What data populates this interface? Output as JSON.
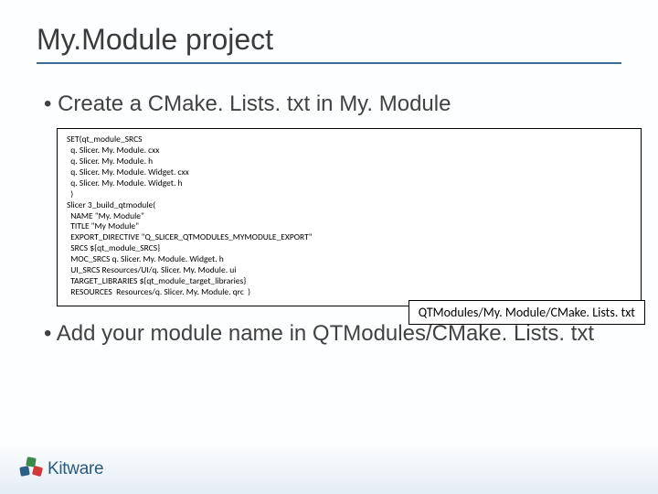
{
  "title": "My.Module project",
  "bullets": {
    "b1": "Create a CMake. Lists. txt in My. Module",
    "b2": "Add your module name in QTModules/CMake. Lists. txt"
  },
  "code": "SET(qt_module_SRCS\n  q. Slicer. My. Module. cxx\n  q. Slicer. My. Module. h\n  q. Slicer. My. Module. Widget. cxx\n  q. Slicer. My. Module. Widget. h\n  )\nSlicer 3_build_qtmodule(\n  NAME \"My. Module\"\n  TITLE \"My Module\"\n  EXPORT_DIRECTIVE \"Q_SLICER_QTMODULES_MYMODULE_EXPORT\"\n  SRCS ${qt_module_SRCS}\n  MOC_SRCS q. Slicer. My. Module. Widget. h\n  UI_SRCS Resources/UI/q. Slicer. My. Module. ui\n  TARGET_LIBRARIES ${qt_module_target_libraries}\n  RESOURCES  Resources/q. Slicer. My. Module. qrc  )",
  "pathLabel": "QTModules/My. Module/CMake. Lists. txt",
  "logoText": "Kitware"
}
